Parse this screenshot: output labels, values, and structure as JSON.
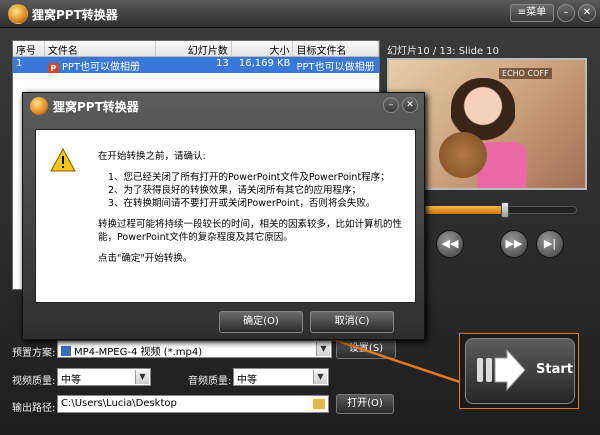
{
  "window": {
    "title": "狸窝PPT转换器",
    "menu_label": "菜单",
    "menu_icon": "≡",
    "minimize": "–",
    "close": "✕"
  },
  "file_table": {
    "headers": [
      "序号",
      "文件名",
      "幻灯片数",
      "大小",
      "目标文件名"
    ],
    "rows": [
      {
        "index": "1",
        "filename": "PPT也可以做相册",
        "slides": "13",
        "size": "16,169 KB",
        "target": "PPT也可以做相册"
      }
    ]
  },
  "preview": {
    "label": "幻灯片10 / 13: Slide 10",
    "sign_text": "ECHO COFF",
    "progress_fraction": 0.6
  },
  "player": {
    "rewind": "◀◀",
    "forward": "▶▶",
    "end": "▶|"
  },
  "settings": {
    "preset_label": "预置方案:",
    "preset_value": "MP4-MPEG-4 视频 (*.mp4)",
    "settings_button": "设置(S)",
    "video_quality_label": "视频质量:",
    "video_quality_value": "中等",
    "audio_quality_label": "音频质量:",
    "audio_quality_value": "中等",
    "output_label": "输出路径:",
    "output_path": "C:\\Users\\Lucia\\Desktop",
    "open_button": "打开(O)"
  },
  "start_button": {
    "label": "Start"
  },
  "dialog": {
    "title": "狸窝PPT转换器",
    "intro": "在开始转换之前，请确认:",
    "items": [
      "1、您已经关闭了所有打开的PowerPoint文件及PowerPoint程序；",
      "2、为了获得良好的转换效果，请关闭所有其它的应用程序；",
      "3、在转换期间请不要打开或关闭PowerPoint，否则将会失败。"
    ],
    "note": "转换过程可能将持续一段较长的时间，相关的因素较多，比如计算机的性能，PowerPoint文件的复杂程度及其它原因。",
    "confirm_prompt": "点击\"确定\"开始转换。",
    "ok_button": "确定(O)",
    "cancel_button": "取消(C)"
  },
  "colors": {
    "accent": "#e87b1c",
    "selection": "#3a78d8"
  }
}
